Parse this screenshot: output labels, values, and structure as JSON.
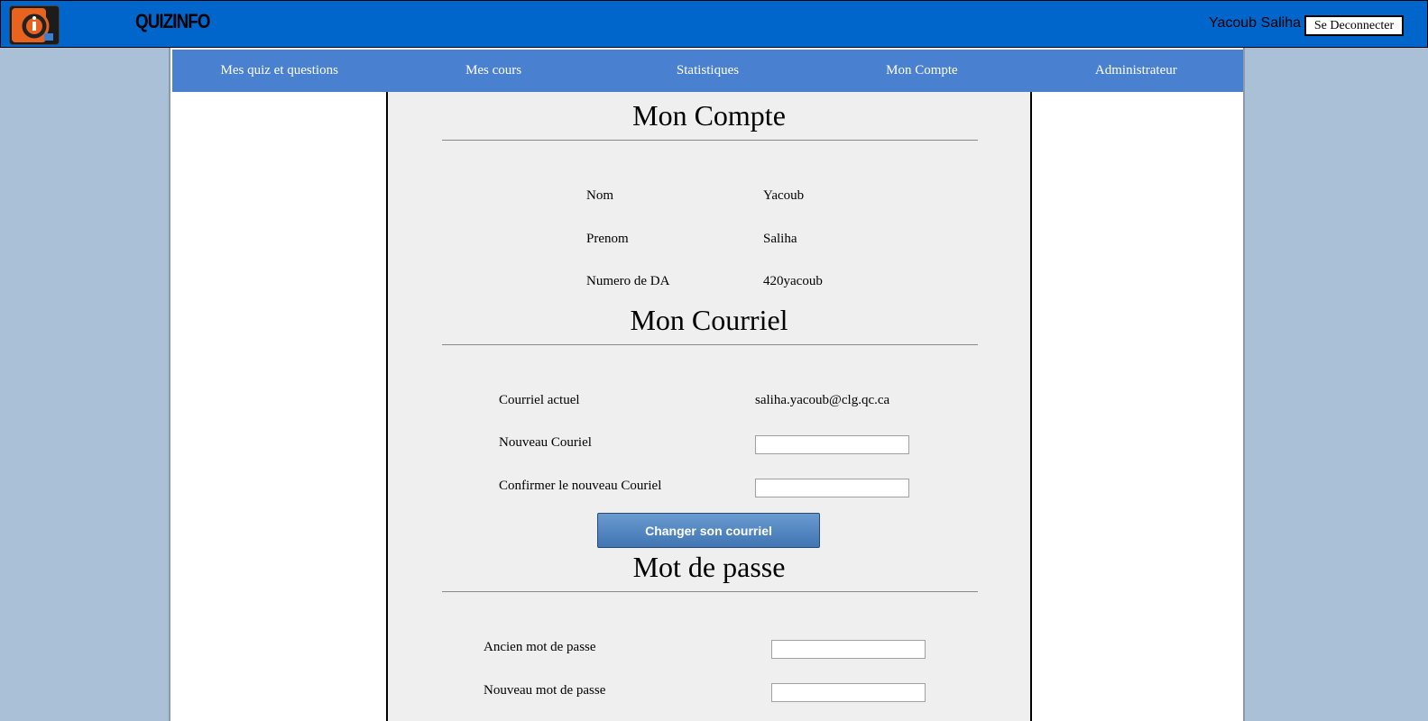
{
  "header": {
    "brand": "QUIZINFO",
    "user_name": "Yacoub Saliha",
    "logout_label": "Se Deconnecter",
    "bg_color": "#0066cc"
  },
  "nav": {
    "items": [
      {
        "label": "Mes quiz et questions"
      },
      {
        "label": "Mes cours"
      },
      {
        "label": "Statistiques"
      },
      {
        "label": "Mon Compte"
      },
      {
        "label": "Administrateur"
      }
    ],
    "bg_color": "#4a80d0"
  },
  "account": {
    "title": "Mon Compte",
    "nom_label": "Nom",
    "nom_value": "Yacoub",
    "prenom_label": "Prenom",
    "prenom_value": "Saliha",
    "da_label": "Numero de DA",
    "da_value": "420yacoub"
  },
  "email": {
    "title": "Mon Courriel",
    "current_label": "Courriel actuel",
    "current_value": "saliha.yacoub@clg.qc.ca",
    "new_label": "Nouveau Couriel",
    "new_value": "",
    "confirm_label": "Confirmer le nouveau Couriel",
    "confirm_value": "",
    "submit_label": "Changer son courriel"
  },
  "password": {
    "title": "Mot de passe",
    "old_label": "Ancien mot de passe",
    "old_value": "",
    "new_label": "Nouveau mot de passe",
    "new_value": ""
  }
}
